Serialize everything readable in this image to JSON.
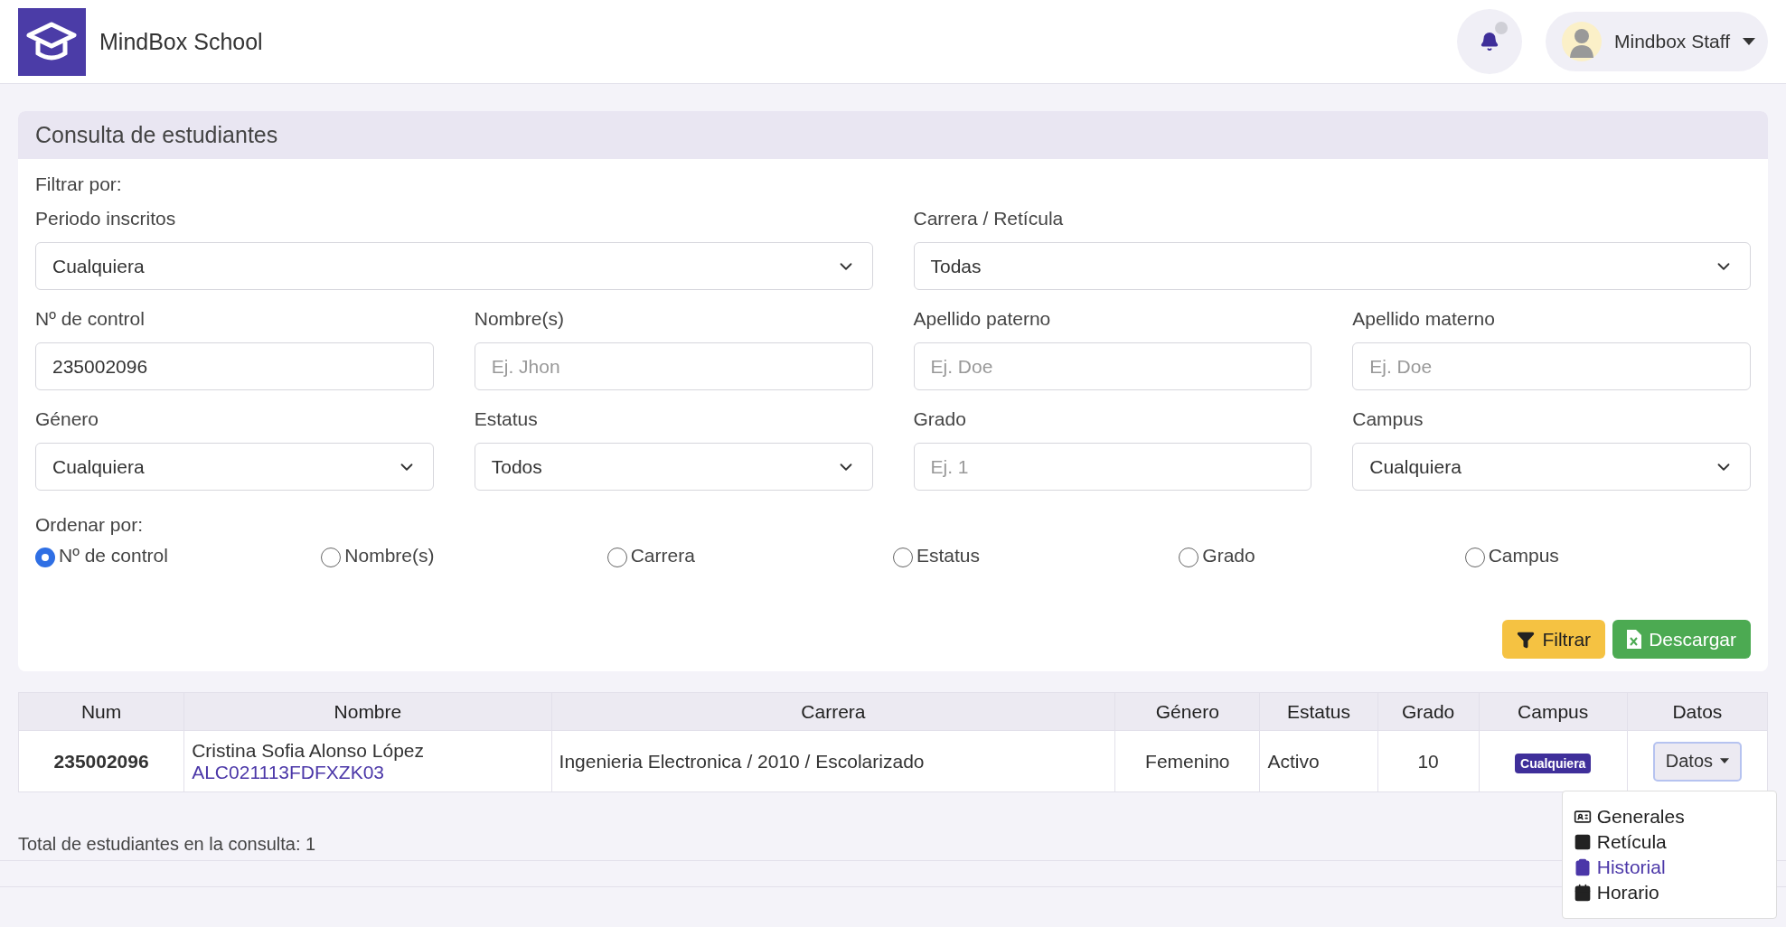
{
  "header": {
    "brand": "MindBox School",
    "notifications": {
      "unread": true
    },
    "user": {
      "name": "Mindbox Staff"
    }
  },
  "panel": {
    "title": "Consulta de estudiantes",
    "filter_label": "Filtrar por:",
    "filter_rows": [
      [
        {
          "label": "Periodo inscritos",
          "kind": "select",
          "value": "Cualquiera"
        },
        {
          "label": "Carrera / Retícula",
          "kind": "select",
          "value": "Todas"
        }
      ],
      [
        {
          "label": "Nº de control",
          "kind": "input",
          "value": "235002096"
        },
        {
          "label": "Nombre(s)",
          "kind": "input",
          "placeholder": "Ej. Jhon"
        },
        {
          "label": "Apellido paterno",
          "kind": "input",
          "placeholder": "Ej. Doe"
        },
        {
          "label": "Apellido materno",
          "kind": "input",
          "placeholder": "Ej. Doe"
        }
      ],
      [
        {
          "label": "Género",
          "kind": "select",
          "value": "Cualquiera"
        },
        {
          "label": "Estatus",
          "kind": "select",
          "value": "Todos"
        },
        {
          "label": "Grado",
          "kind": "input",
          "placeholder": "Ej. 1"
        },
        {
          "label": "Campus",
          "kind": "select",
          "value": "Cualquiera"
        }
      ]
    ],
    "sort": {
      "label": "Ordenar por:",
      "options": [
        {
          "label": "Nº de control",
          "selected": true
        },
        {
          "label": "Nombre(s)",
          "selected": false
        },
        {
          "label": "Carrera",
          "selected": false
        },
        {
          "label": "Estatus",
          "selected": false
        },
        {
          "label": "Grado",
          "selected": false
        },
        {
          "label": "Campus",
          "selected": false
        }
      ]
    },
    "actions": [
      {
        "label": "Filtrar",
        "kind": "filter"
      },
      {
        "label": "Descargar",
        "kind": "download"
      }
    ]
  },
  "table": {
    "columns": [
      "Num",
      "Nombre",
      "Carrera",
      "Género",
      "Estatus",
      "Grado",
      "Campus",
      "Datos"
    ],
    "rows": [
      {
        "num": "235002096",
        "name": "Cristina Sofia Alonso López",
        "code": "ALC021113FDFXZK03",
        "carrera": "Ingenieria Electronica / 2010 / Escolarizado",
        "genero": "Femenino",
        "estatus": "Activo",
        "grado": "10",
        "campus": "Cualquiera",
        "datos": "Datos"
      }
    ]
  },
  "menu": {
    "items": [
      {
        "label": "Generales",
        "selected": false
      },
      {
        "label": "Retícula",
        "selected": false
      },
      {
        "label": "Historial",
        "selected": true
      },
      {
        "label": "Horario",
        "selected": false
      }
    ]
  },
  "total": "Total de estudiantes en la consulta: 1"
}
